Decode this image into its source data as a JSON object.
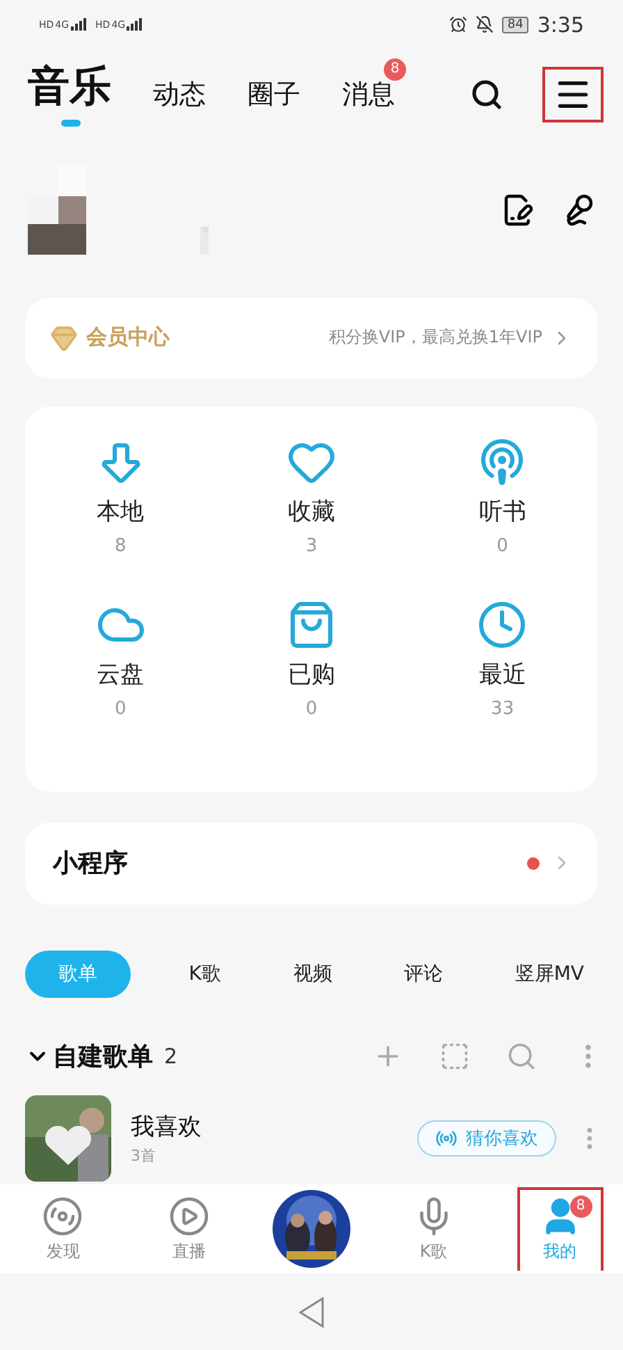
{
  "status_bar": {
    "sims": [
      {
        "hd": "HD",
        "net": "4G"
      },
      {
        "hd": "HD",
        "net": "4G"
      }
    ],
    "battery": "84",
    "time": "3:35"
  },
  "top_tabs": [
    {
      "label": "音乐",
      "selected": true
    },
    {
      "label": "动态",
      "selected": false
    },
    {
      "label": "圈子",
      "selected": false
    },
    {
      "label": "消息",
      "selected": false,
      "badge": "8"
    }
  ],
  "menu_highlighted": true,
  "vip": {
    "title": "会员中心",
    "promo": "积分换VIP，最高兑换1年VIP"
  },
  "shortcuts": [
    {
      "kind": "local",
      "label": "本地",
      "count": "8"
    },
    {
      "kind": "favorite",
      "label": "收藏",
      "count": "3"
    },
    {
      "kind": "audiobook",
      "label": "听书",
      "count": "0"
    },
    {
      "kind": "cloud",
      "label": "云盘",
      "count": "0"
    },
    {
      "kind": "purchased",
      "label": "已购",
      "count": "0"
    },
    {
      "kind": "recent",
      "label": "最近",
      "count": "33"
    }
  ],
  "mini_programs": {
    "title": "小程序",
    "unread": true
  },
  "content_tabs": [
    {
      "label": "歌单",
      "selected": true
    },
    {
      "label": "K歌",
      "selected": false
    },
    {
      "label": "视频",
      "selected": false
    },
    {
      "label": "评论",
      "selected": false
    },
    {
      "label": "竖屏MV",
      "selected": false
    }
  ],
  "section": {
    "title": "自建歌单",
    "count": "2",
    "expanded": true
  },
  "playlists": [
    {
      "title": "我喜欢",
      "subtitle": "3首",
      "action": "猜你喜欢"
    }
  ],
  "bottom_nav": [
    {
      "kind": "discover",
      "label": "发现",
      "selected": false,
      "highlighted": false
    },
    {
      "kind": "live",
      "label": "直播",
      "selected": false,
      "highlighted": false
    },
    {
      "kind": "player"
    },
    {
      "kind": "karaoke",
      "label": "K歌",
      "selected": false,
      "highlighted": false
    },
    {
      "kind": "mine",
      "label": "我的",
      "selected": true,
      "badge": "8",
      "highlighted": true
    }
  ]
}
